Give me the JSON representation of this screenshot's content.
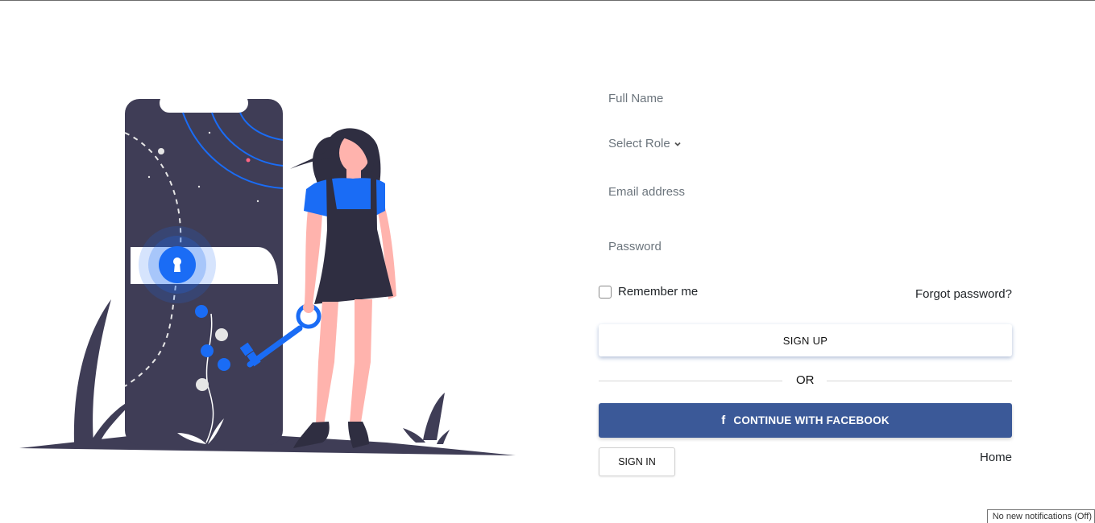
{
  "form": {
    "full_name_placeholder": "Full Name",
    "select_role_label": "Select Role",
    "email_placeholder": "Email address",
    "password_placeholder": "Password",
    "remember_label": "Remember me",
    "forgot_label": "Forgot password?",
    "signup_label": "SIGN UP",
    "or_label": "OR",
    "facebook_label": "CONTINUE WITH FACEBOOK",
    "facebook_icon": "f",
    "signin_label": "SIGN IN",
    "home_label": "Home"
  },
  "status": {
    "notifications": "No new notifications (Off)"
  },
  "colors": {
    "accent_blue": "#1a6cf5",
    "facebook_blue": "#3b5998",
    "phone_dark": "#3f3d56",
    "skin": "#ffb3ad"
  },
  "icons": {
    "facebook": "facebook-icon",
    "chevron": "chevron-down-icon",
    "lock": "keyhole-icon",
    "key": "key-icon"
  }
}
